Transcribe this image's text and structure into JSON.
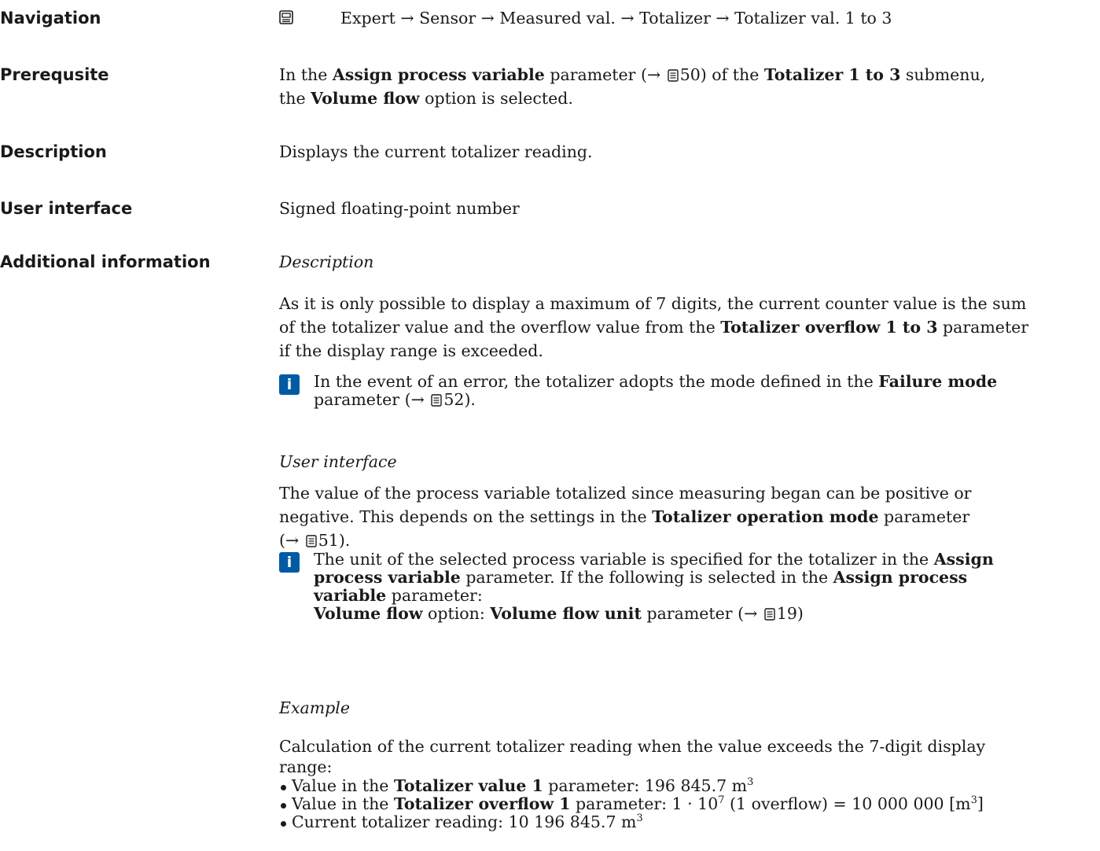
{
  "navigation": {
    "label": "Navigation",
    "icon": "display-icon",
    "p1": "Expert",
    "p2": "Sensor",
    "p3": "Measured val.",
    "p4": "Totalizer",
    "p5": "Totalizer val. 1 to 3",
    "arrow": "→"
  },
  "prerequisite": {
    "label": "Prerequsite",
    "t1": "In the ",
    "b1": "Assign process variable",
    "t2": " parameter (",
    "arrow": "→",
    "ref1": "50",
    "t3": ") of the ",
    "b2": "Totalizer 1 to 3",
    "t4": " submenu,",
    "t5": "the ",
    "b3": "Volume flow",
    "t6": " option is selected."
  },
  "description": {
    "label": "Description",
    "text": "Displays the current totalizer reading."
  },
  "user_interface": {
    "label": "User interface",
    "text": "Signed floating-point number"
  },
  "additional": {
    "label": "Additional information",
    "h_description": "Description",
    "p1_l1": "As it is only possible to display a maximum of 7 digits, the current counter value is the sum",
    "p1_l2a": "of the totalizer value and the overflow value from the ",
    "p1_l2b": "Totalizer overflow 1 to 3",
    "p1_l2c": " parameter",
    "p1_l3": "if the display range is exceeded.",
    "hint1_a": "In the event of an error, the totalizer adopts the mode defined in the ",
    "hint1_b": "Failure mode",
    "hint1_c": "parameter (",
    "hint1_ref": "52",
    "hint1_d": ").",
    "h_user_interface": "User interface",
    "p2_l1": "The value of the process variable totalized since measuring began can be positive or",
    "p2_l2a": "negative. This depends on the settings in the ",
    "p2_l2b": "Totalizer operation mode",
    "p2_l2c": " parameter",
    "p2_ref": "51",
    "p2_end": ").",
    "hint2_l1a": "The unit of the selected process variable is specified for the totalizer in the ",
    "hint2_l1b": "Assign",
    "hint2_l2a": "process variable",
    "hint2_l2b": " parameter. If the following is selected in the ",
    "hint2_l2c": "Assign process",
    "hint2_l3a": "variable",
    "hint2_l3b": " parameter:",
    "hint2_l4a": "Volume flow",
    "hint2_l4b": " option: ",
    "hint2_l4c": "Volume flow unit",
    "hint2_l4d": " parameter (",
    "hint2_ref": "19",
    "hint2_l4e": ")",
    "h_example": "Example",
    "ex_l1": "Calculation of the current totalizer reading when the value exceeds the 7-digit display",
    "ex_l2": "range:",
    "b1_a": "Value in the ",
    "b1_b": "Totalizer value 1",
    "b1_c": " parameter: 196 845.7 m",
    "b2_a": "Value in the ",
    "b2_b": "Totalizer overflow 1",
    "b2_c": " parameter: 1 · 10",
    "b2_d": " (1 overflow) = 10 000 000 [m",
    "b2_e": "]",
    "b3_a": "Current totalizer reading: 10 196 845.7 m",
    "sup3": "3",
    "sup7": "7",
    "open_paren": "("
  }
}
